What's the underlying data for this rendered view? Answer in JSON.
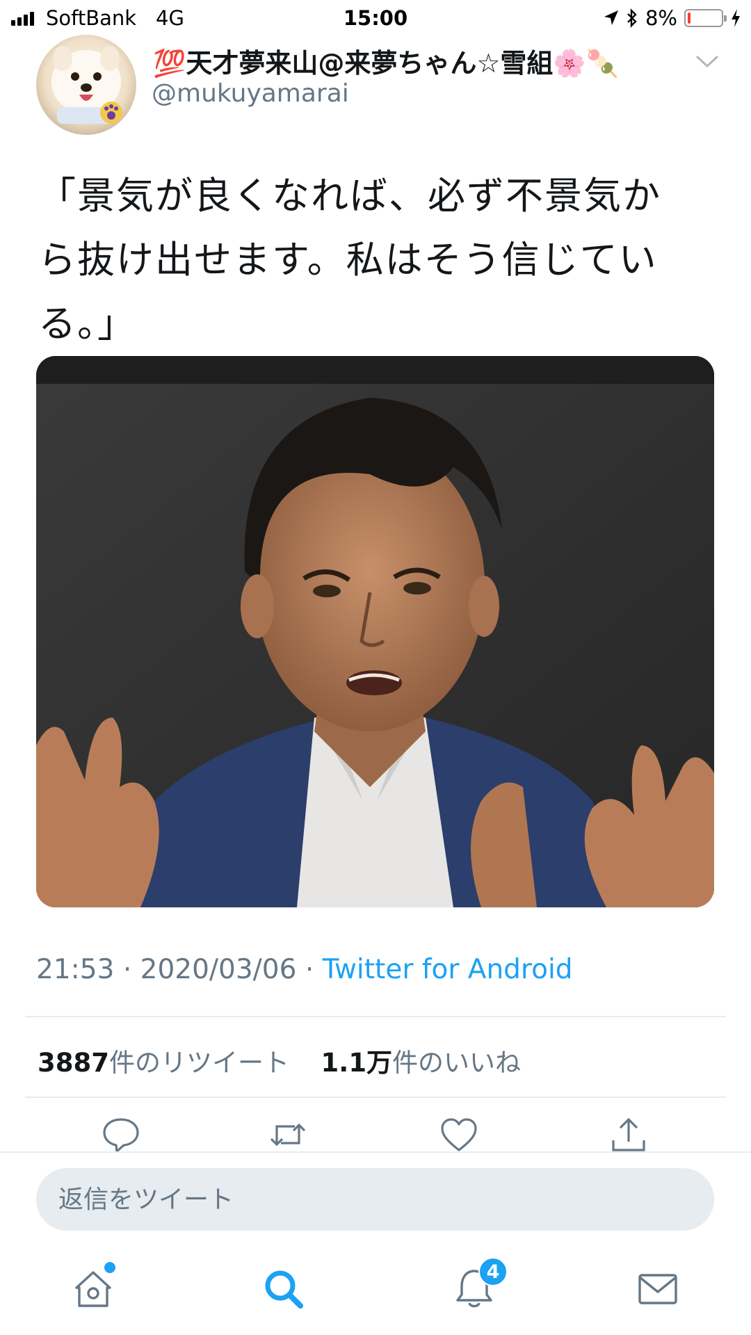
{
  "status_bar": {
    "carrier": "SoftBank",
    "network": "4G",
    "time": "15:00",
    "battery": "8%",
    "battery_level": 0.08,
    "icons": [
      "signal-icon",
      "location-arrow-icon",
      "bluetooth-icon",
      "battery-icon",
      "charging-bolt-icon"
    ]
  },
  "tweet": {
    "display_name": "💯天才夢来山@来夢ちゃん☆雪組🌸🍡",
    "handle": "@mukuyamarai",
    "text_lines": [
      "「景気が良くなれば、必ず不景気か",
      "ら抜け出せます。私はそう信じてい",
      "る。」"
    ],
    "time": "21:53",
    "date": "2020/03/06",
    "separator": "·",
    "source": "Twitter for Android"
  },
  "stats": {
    "retweets_count": "3887",
    "retweets_label": "件のリツイート",
    "likes_count": "1.1万",
    "likes_label": "件のいいね"
  },
  "actions": [
    "reply-icon",
    "retweet-icon",
    "like-icon",
    "share-icon"
  ],
  "reply": {
    "placeholder": "返信をツイート"
  },
  "tab_bar": {
    "tabs": [
      "home-icon",
      "search-icon",
      "notifications-icon",
      "messages-icon"
    ],
    "notifications_badge": "4"
  },
  "colors": {
    "accent": "#1da1f2",
    "text": "#14171a",
    "secondary": "#657786",
    "divider": "#e6ecf0",
    "battery_low": "#ff3b30"
  }
}
